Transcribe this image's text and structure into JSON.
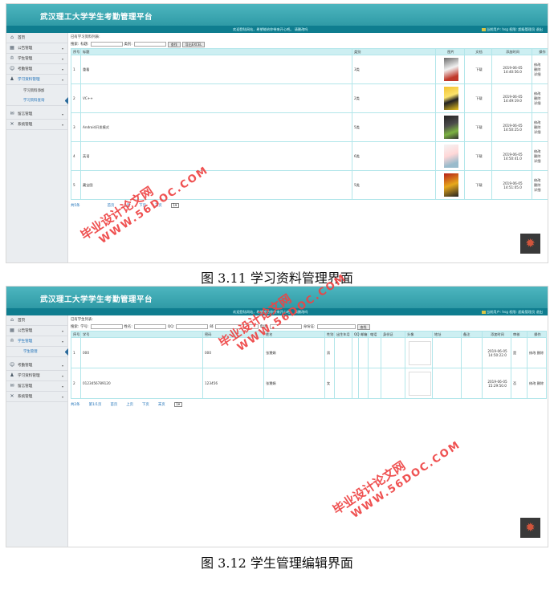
{
  "screen1": {
    "app_title": "武汉理工大学学生考勤管理平台",
    "welcome": "欢迎登陆网站，希望能给你带来开心吧。  请删改吗",
    "user_bar": "当前用户: hsg 权限: 超级管理员 退出",
    "sidebar": [
      {
        "label": "首页"
      },
      {
        "label": "公告管理"
      },
      {
        "label": "学生管理"
      },
      {
        "label": "考勤管理"
      },
      {
        "label": "学习资料管理"
      },
      {
        "label": "学习资料添加"
      },
      {
        "label": "学习资料查询"
      },
      {
        "label": "留言管理"
      },
      {
        "label": "系统管理"
      }
    ],
    "breadcrumb": "已有学习资料列表:",
    "search": {
      "keyword_label": "搜索:",
      "title_label": "标题:",
      "type_label": "类别:",
      "search_btn": "查找",
      "export_btn": "导出EXCEL"
    },
    "headers": [
      "序号",
      "标题",
      "类别",
      "图片",
      "文档",
      "添加时间",
      "操作"
    ],
    "rows": [
      {
        "no": "1",
        "title": "重看",
        "cat": "3类",
        "doc": "下载",
        "time": "2019-06-05 14:40:56.0",
        "ops": [
          "修改",
          "删除",
          "详细"
        ]
      },
      {
        "no": "2",
        "title": "VC++",
        "cat": "2类",
        "doc": "下载",
        "time": "2019-06-05 14:49:19.0",
        "ops": [
          "修改",
          "删除",
          "详细"
        ]
      },
      {
        "no": "3",
        "title": "Android开发模式",
        "cat": "5类",
        "doc": "下载",
        "time": "2019-06-05 14:50:25.0",
        "ops": [
          "修改",
          "删除",
          "详细"
        ]
      },
      {
        "no": "4",
        "title": "英语",
        "cat": "6类",
        "doc": "下载",
        "time": "2019-06-05 14:50:41.0",
        "ops": [
          "修改",
          "删除",
          "详细"
        ]
      },
      {
        "no": "5",
        "title": "藏宝图",
        "cat": "5类",
        "doc": "下载",
        "time": "2019-06-05 14:51:05.0",
        "ops": [
          "修改",
          "删除",
          "详细"
        ]
      }
    ],
    "pager": {
      "total": "共5条",
      "first": "首页",
      "prev": "上页",
      "next": "下页",
      "last": "末页",
      "page": "1"
    }
  },
  "caption1": "图 3.11 学习资料管理界面",
  "screen2": {
    "app_title": "武汉理工大学学生考勤管理平台",
    "welcome": "欢迎登陆网站，希望能给你带来开心吧。  请删改吗",
    "user_bar": "当前用户: hsg 权限: 超级管理员 退出",
    "sidebar": [
      {
        "label": "首页"
      },
      {
        "label": "公告管理"
      },
      {
        "label": "学生管理"
      },
      {
        "label": "学生管理"
      },
      {
        "label": "考勤管理"
      },
      {
        "label": "学习资料管理"
      },
      {
        "label": "留言管理"
      },
      {
        "label": "系统管理"
      }
    ],
    "breadcrumb": "已有学生列表:",
    "search": {
      "keyword_label": "搜索:",
      "f1": "学号:",
      "f2": "姓名:",
      "f3": "QQ:",
      "f4": "邮",
      "f5": "电话:",
      "f6": "身份证:",
      "search_btn": "查找"
    },
    "headers": [
      "序号",
      "学号",
      "密码",
      "姓名",
      "性别",
      "出生年月",
      "QQ",
      "邮箱",
      "电话",
      "身份证",
      "头像",
      "地址",
      "备注",
      "添加时间",
      "审核",
      "操作"
    ],
    "rows": [
      {
        "no": "1",
        "id": "000",
        "pwd": "000",
        "name": "张慧娟",
        "sex": "男",
        "time": "2019-06-05 14:50:22.0",
        "audit": "是",
        "ops": [
          "修改",
          "删除"
        ]
      },
      {
        "no": "2",
        "id": "0123456789120",
        "pwd": "123456",
        "name": "张慧娟",
        "sex": "女",
        "time": "2019-06-05 15:29:50.0",
        "audit": "否",
        "ops": [
          "修改",
          "删除"
        ]
      }
    ],
    "pager": {
      "total": "共2条",
      "pages": "第1/1页",
      "first": "首页",
      "prev": "上页",
      "next": "下页",
      "last": "末页",
      "page": "1"
    }
  },
  "caption2": "图 3.12 学生管理编辑界面",
  "watermark": {
    "cn": "毕业设计论文网",
    "en": "WWW.56DOC.COM"
  },
  "colors": {
    "header": "#2f9aa6",
    "subbar": "#0f7d8f",
    "table_head": "#cdeff2",
    "link": "#1b6fb7",
    "watermark": "#ee4444"
  },
  "icons": [
    "home-icon",
    "grid-icon",
    "student-icon",
    "user-icon",
    "person-icon",
    "message-icon",
    "tools-icon",
    "gear-icon"
  ]
}
